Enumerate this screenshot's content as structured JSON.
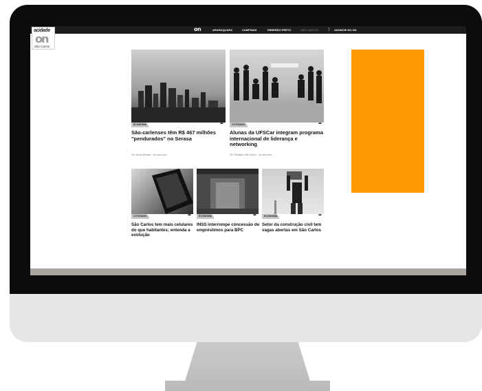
{
  "nav": {
    "logo": "on",
    "items": [
      "ARARAQUARA",
      "CAMPINAS",
      "RIBEIRÃO PRETO",
      "SÃO CARLOS"
    ],
    "separator": "|",
    "advertise": "ANUNCIE NO ON"
  },
  "brand": {
    "top": "acidade",
    "on": "on",
    "city": "São Carlos"
  },
  "articles": [
    {
      "tag": "ECONOMIA",
      "title": "São-carlenses têm R$ 467 milhões \"pendurados\" no Serasa",
      "meta": "De: Bruna Moraes - há uma hora"
    },
    {
      "tag": "COTIDIANO",
      "title": "Alunas da UFSCar integram programa internacional de liderança e networking",
      "meta": "De: Redação São Carlos - há uma hora"
    },
    {
      "tag": "COTIDIANO",
      "title": "São Carlos tem mais celulares do que habitantes; entenda a evolução"
    },
    {
      "tag": "ECONOMIA",
      "title": "INSS interrompe concessão de empréstimos para BPC"
    },
    {
      "tag": "ECONOMIA",
      "title": "Setor da construção civil tem vagas abertas em São Carlos"
    }
  ],
  "colors": {
    "ad": "#ff9800",
    "topbar": "#1d1d1d",
    "tag": "#c7c7c7"
  },
  "icons": {
    "share": "share-arrow-icon"
  }
}
